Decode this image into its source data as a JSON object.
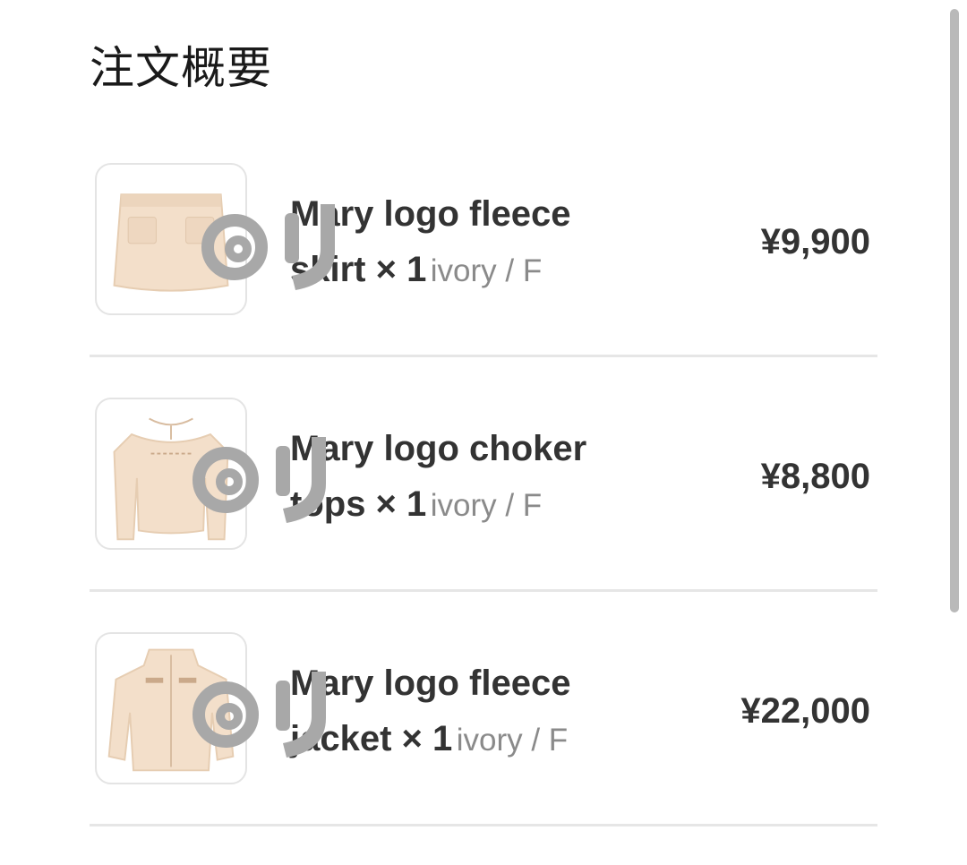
{
  "header": {
    "title": "注文概要"
  },
  "items": [
    {
      "name_line1": "Mary logo fleece",
      "name_line2": "skirt × 1",
      "variant": "ivory / F",
      "price": "¥9,900",
      "image": "skirt-image"
    },
    {
      "name_line1": "Mary logo choker",
      "name_line2": "tops × 1",
      "variant": "ivory / F",
      "price": "¥8,800",
      "image": "tops-image"
    },
    {
      "name_line1": "Mary logo fleece",
      "name_line2": "jacket × 1",
      "variant": "ivory / F",
      "price": "¥22,000",
      "image": "jacket-image"
    }
  ],
  "colors": {
    "product_tint": "#f3dfca",
    "watermark": "#a8a8a8"
  }
}
